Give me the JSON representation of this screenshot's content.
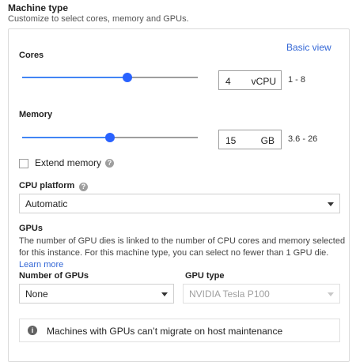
{
  "header": {
    "title": "Machine type",
    "subtitle": "Customize to select cores, memory and GPUs."
  },
  "basic_view_link": "Basic view",
  "cores": {
    "label": "Cores",
    "value": "4",
    "unit": "vCPU",
    "range": "1 - 8",
    "slider_fraction": 0.6
  },
  "memory": {
    "label": "Memory",
    "value": "15",
    "unit": "GB",
    "range": "3.6 - 26",
    "slider_fraction": 0.5
  },
  "extend_memory": {
    "label": "Extend memory",
    "checked": false,
    "help_icon": "question-circle-icon"
  },
  "cpu_platform": {
    "label": "CPU platform",
    "selected": "Automatic",
    "help_icon": "question-circle-icon"
  },
  "gpus": {
    "heading": "GPUs",
    "description_line1": "The number of GPU dies is linked to the number of CPU cores and memory selected",
    "description_line2": "for this instance. For this machine type, you can select no fewer than 1 GPU die.",
    "learn_more": "Learn more",
    "count_label": "Number of GPUs",
    "count_selected": "None",
    "type_label": "GPU type",
    "type_selected": "NVIDIA Tesla P100"
  },
  "notice": {
    "icon": "info-icon",
    "text": "Machines with GPUs can’t migrate on host maintenance"
  },
  "colors": {
    "accent": "#4285f4",
    "thumb": "#2962ff",
    "link": "#3367d6"
  }
}
